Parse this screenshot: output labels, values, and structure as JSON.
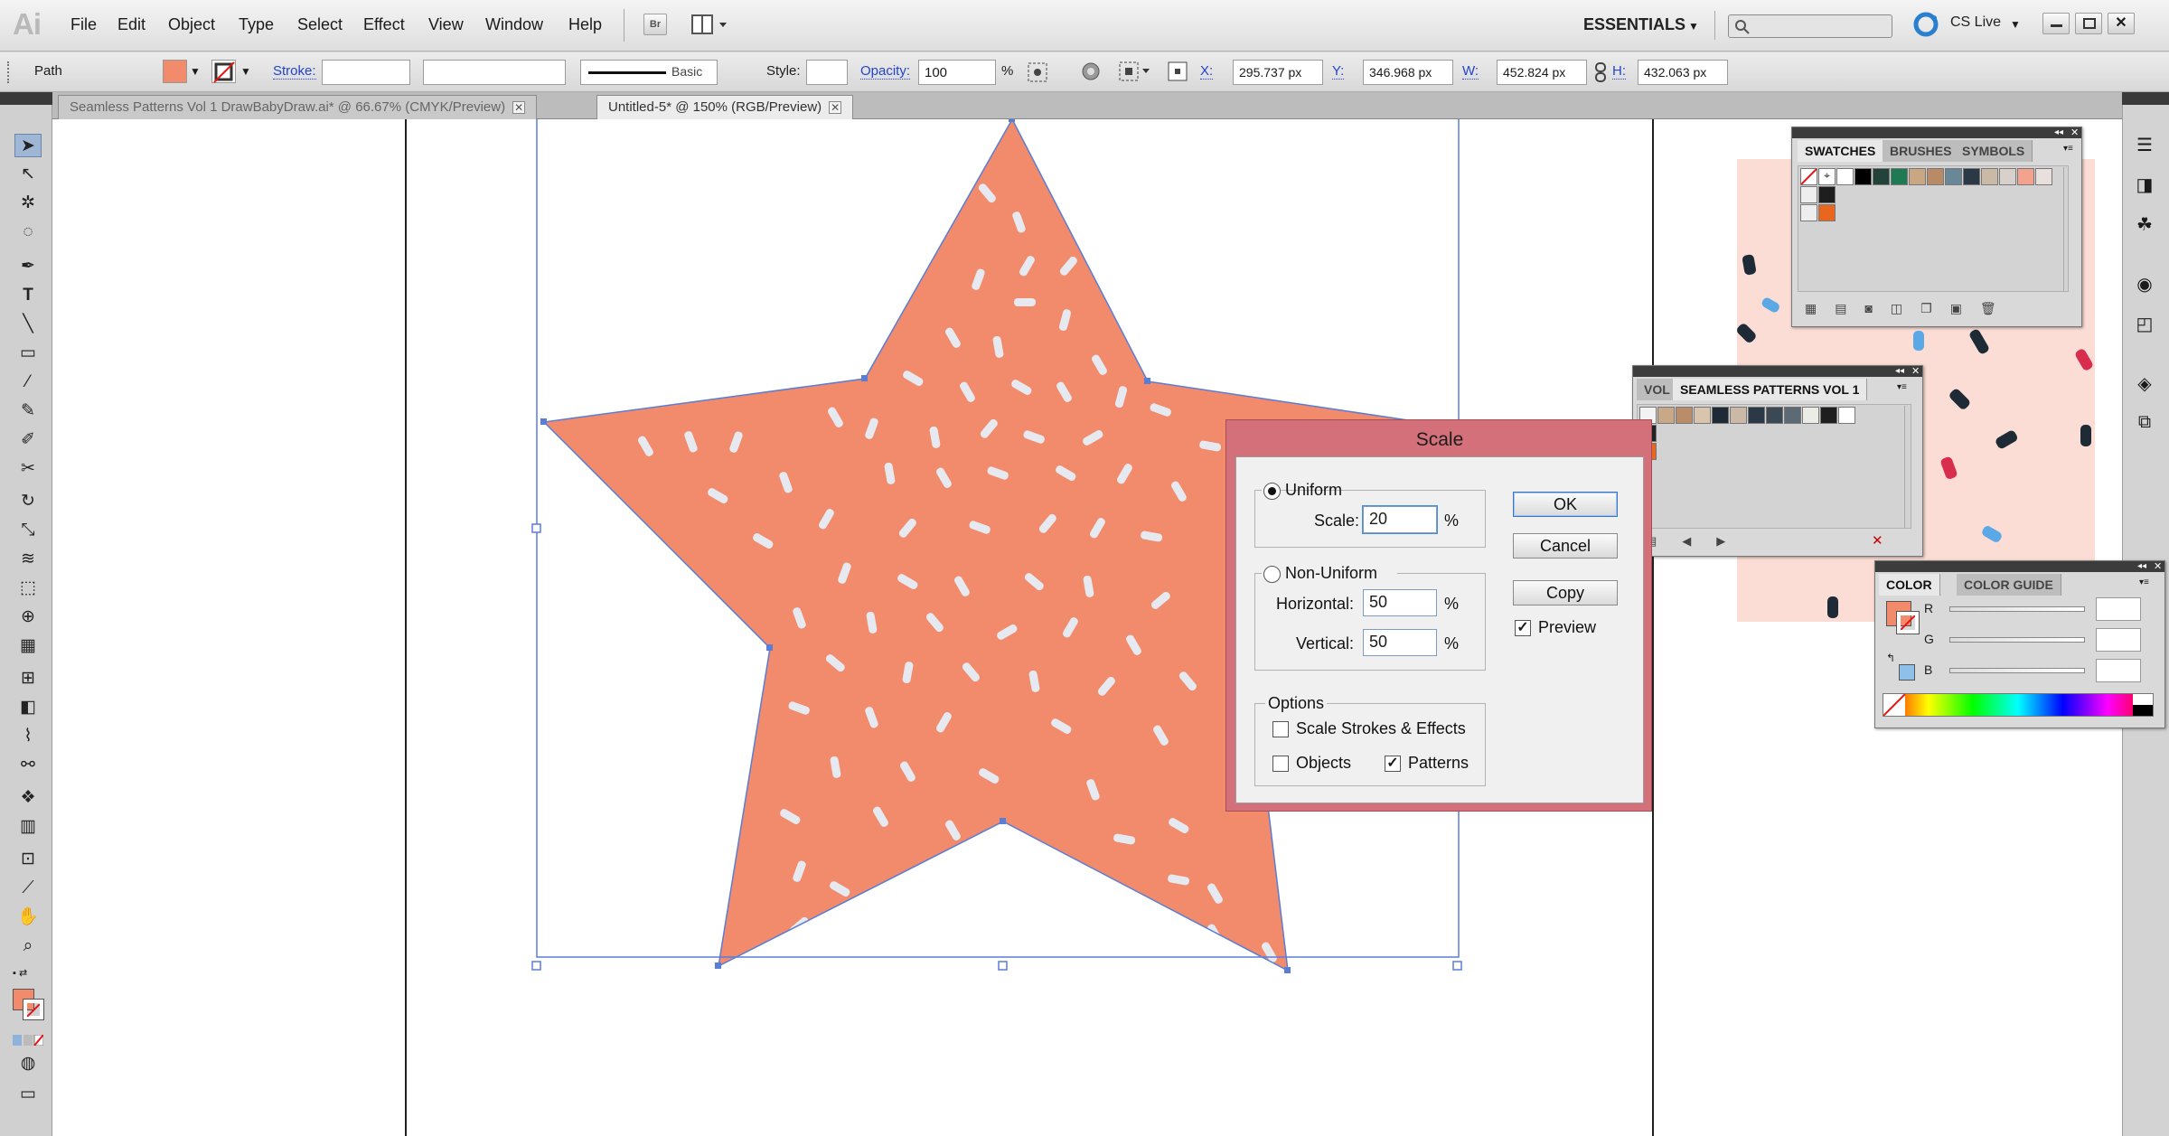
{
  "app": {
    "logo": "Ai",
    "workspace": "ESSENTIALS",
    "cs_live": "CS Live",
    "bridge_label": "Br"
  },
  "menu": [
    "File",
    "Edit",
    "Object",
    "Type",
    "Select",
    "Effect",
    "View",
    "Window",
    "Help"
  ],
  "control_bar": {
    "selection_type": "Path",
    "stroke_label": "Stroke:",
    "brush_label": "Basic",
    "style_label": "Style:",
    "opacity_label": "Opacity:",
    "opacity_value": "100",
    "opacity_unit": "%",
    "x_label": "X:",
    "x_value": "295.737 px",
    "y_label": "Y:",
    "y_value": "346.968 px",
    "w_label": "W:",
    "w_value": "452.824 px",
    "h_label": "H:",
    "h_value": "432.063 px"
  },
  "tabs": [
    {
      "label": "Seamless Patterns Vol 1 DrawBabyDraw.ai* @ 66.67% (CMYK/Preview)",
      "active": false
    },
    {
      "label": "Untitled-5* @ 150% (RGB/Preview)",
      "active": true
    }
  ],
  "tab_close": "✕",
  "swatches_panel": {
    "tabs": [
      "SWATCHES",
      "BRUSHES",
      "SYMBOLS"
    ]
  },
  "seamless_panel": {
    "tabs": [
      "VOL",
      "SEAMLESS PATTERNS VOL 1"
    ]
  },
  "color_panel": {
    "tabs": [
      "COLOR",
      "COLOR GUIDE"
    ],
    "channels": [
      "R",
      "G",
      "B"
    ]
  },
  "scale_dialog": {
    "title": "Scale",
    "uniform_label": "Uniform",
    "scale_label": "Scale:",
    "scale_value": "20",
    "non_uniform_label": "Non-Uniform",
    "horizontal_label": "Horizontal:",
    "horizontal_value": "50",
    "vertical_label": "Vertical:",
    "vertical_value": "50",
    "percent": "%",
    "options_label": "Options",
    "scale_strokes_label": "Scale Strokes & Effects",
    "objects_label": "Objects",
    "patterns_label": "Patterns",
    "ok_label": "OK",
    "cancel_label": "Cancel",
    "copy_label": "Copy",
    "preview_label": "Preview",
    "uniform_selected": true,
    "scale_strokes_checked": false,
    "objects_checked": false,
    "patterns_checked": true,
    "preview_checked": true
  },
  "colors": {
    "fill": "#f28a6c",
    "dialog_title_bar": "#d4707a",
    "pattern_bg": "#fbddd5",
    "sprinkle_light": "#e6eaf0",
    "sprinkle_dark": "#1e2a36",
    "sprinkle_blue": "#5aa8e6",
    "sprinkle_red": "#d92d4e"
  }
}
